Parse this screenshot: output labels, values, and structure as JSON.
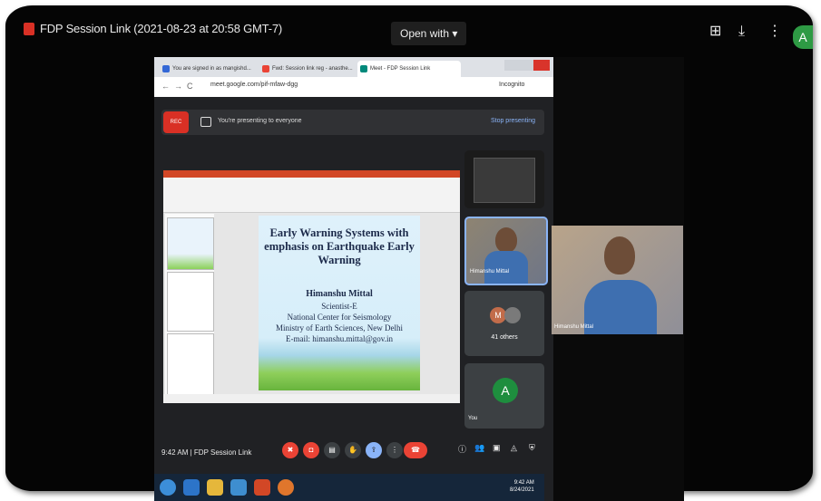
{
  "viewer": {
    "title": "FDP Session Link (2021-08-23 at 20:58 GMT-7)",
    "open_with": "Open with",
    "icons": [
      "add-to-drive-icon",
      "download-icon",
      "more-vert-icon"
    ],
    "avatar_letter": "A"
  },
  "chrome": {
    "tabs": [
      {
        "label": "You are signed in as mangishd...",
        "favicon_color": "#3367d6"
      },
      {
        "label": "Fwd: Session link reg - anasthe...",
        "favicon_color": "#ea4335"
      },
      {
        "label": "Meet - FDP Session Link",
        "favicon_color": "#00897b"
      }
    ],
    "url": "meet.google.com/pif-mfaw-dgg",
    "incognito": "Incognito"
  },
  "present_bar": {
    "rec": "REC",
    "message": "You're presenting to everyone",
    "stop": "Stop presenting"
  },
  "slide": {
    "title": "Early Warning Systems with emphasis on Earthquake Early Warning",
    "author": "Himanshu Mittal",
    "lines": [
      "Scientist-E",
      "National Center for Seismology",
      "Ministry of Earth Sciences, New Delhi",
      "E-mail: himanshu.mittal@gov.in"
    ]
  },
  "tiles": {
    "himanshu_name": "Himanshu Mittal",
    "others_initial": "M",
    "others_count": "41 others",
    "you_initial": "A",
    "you_label": "You"
  },
  "big_video": {
    "name": "Himanshu Mittal"
  },
  "meet_bar": {
    "time_label": "9:42 AM",
    "separator": "|",
    "meeting_name": "FDP Session Link"
  },
  "taskbar": {
    "time": "9:42 AM",
    "date": "8/24/2021"
  },
  "colors": {
    "accent_red": "#ea4335",
    "accent_blue": "#8ab4f8",
    "incognito_green": "#1e8e3e"
  }
}
